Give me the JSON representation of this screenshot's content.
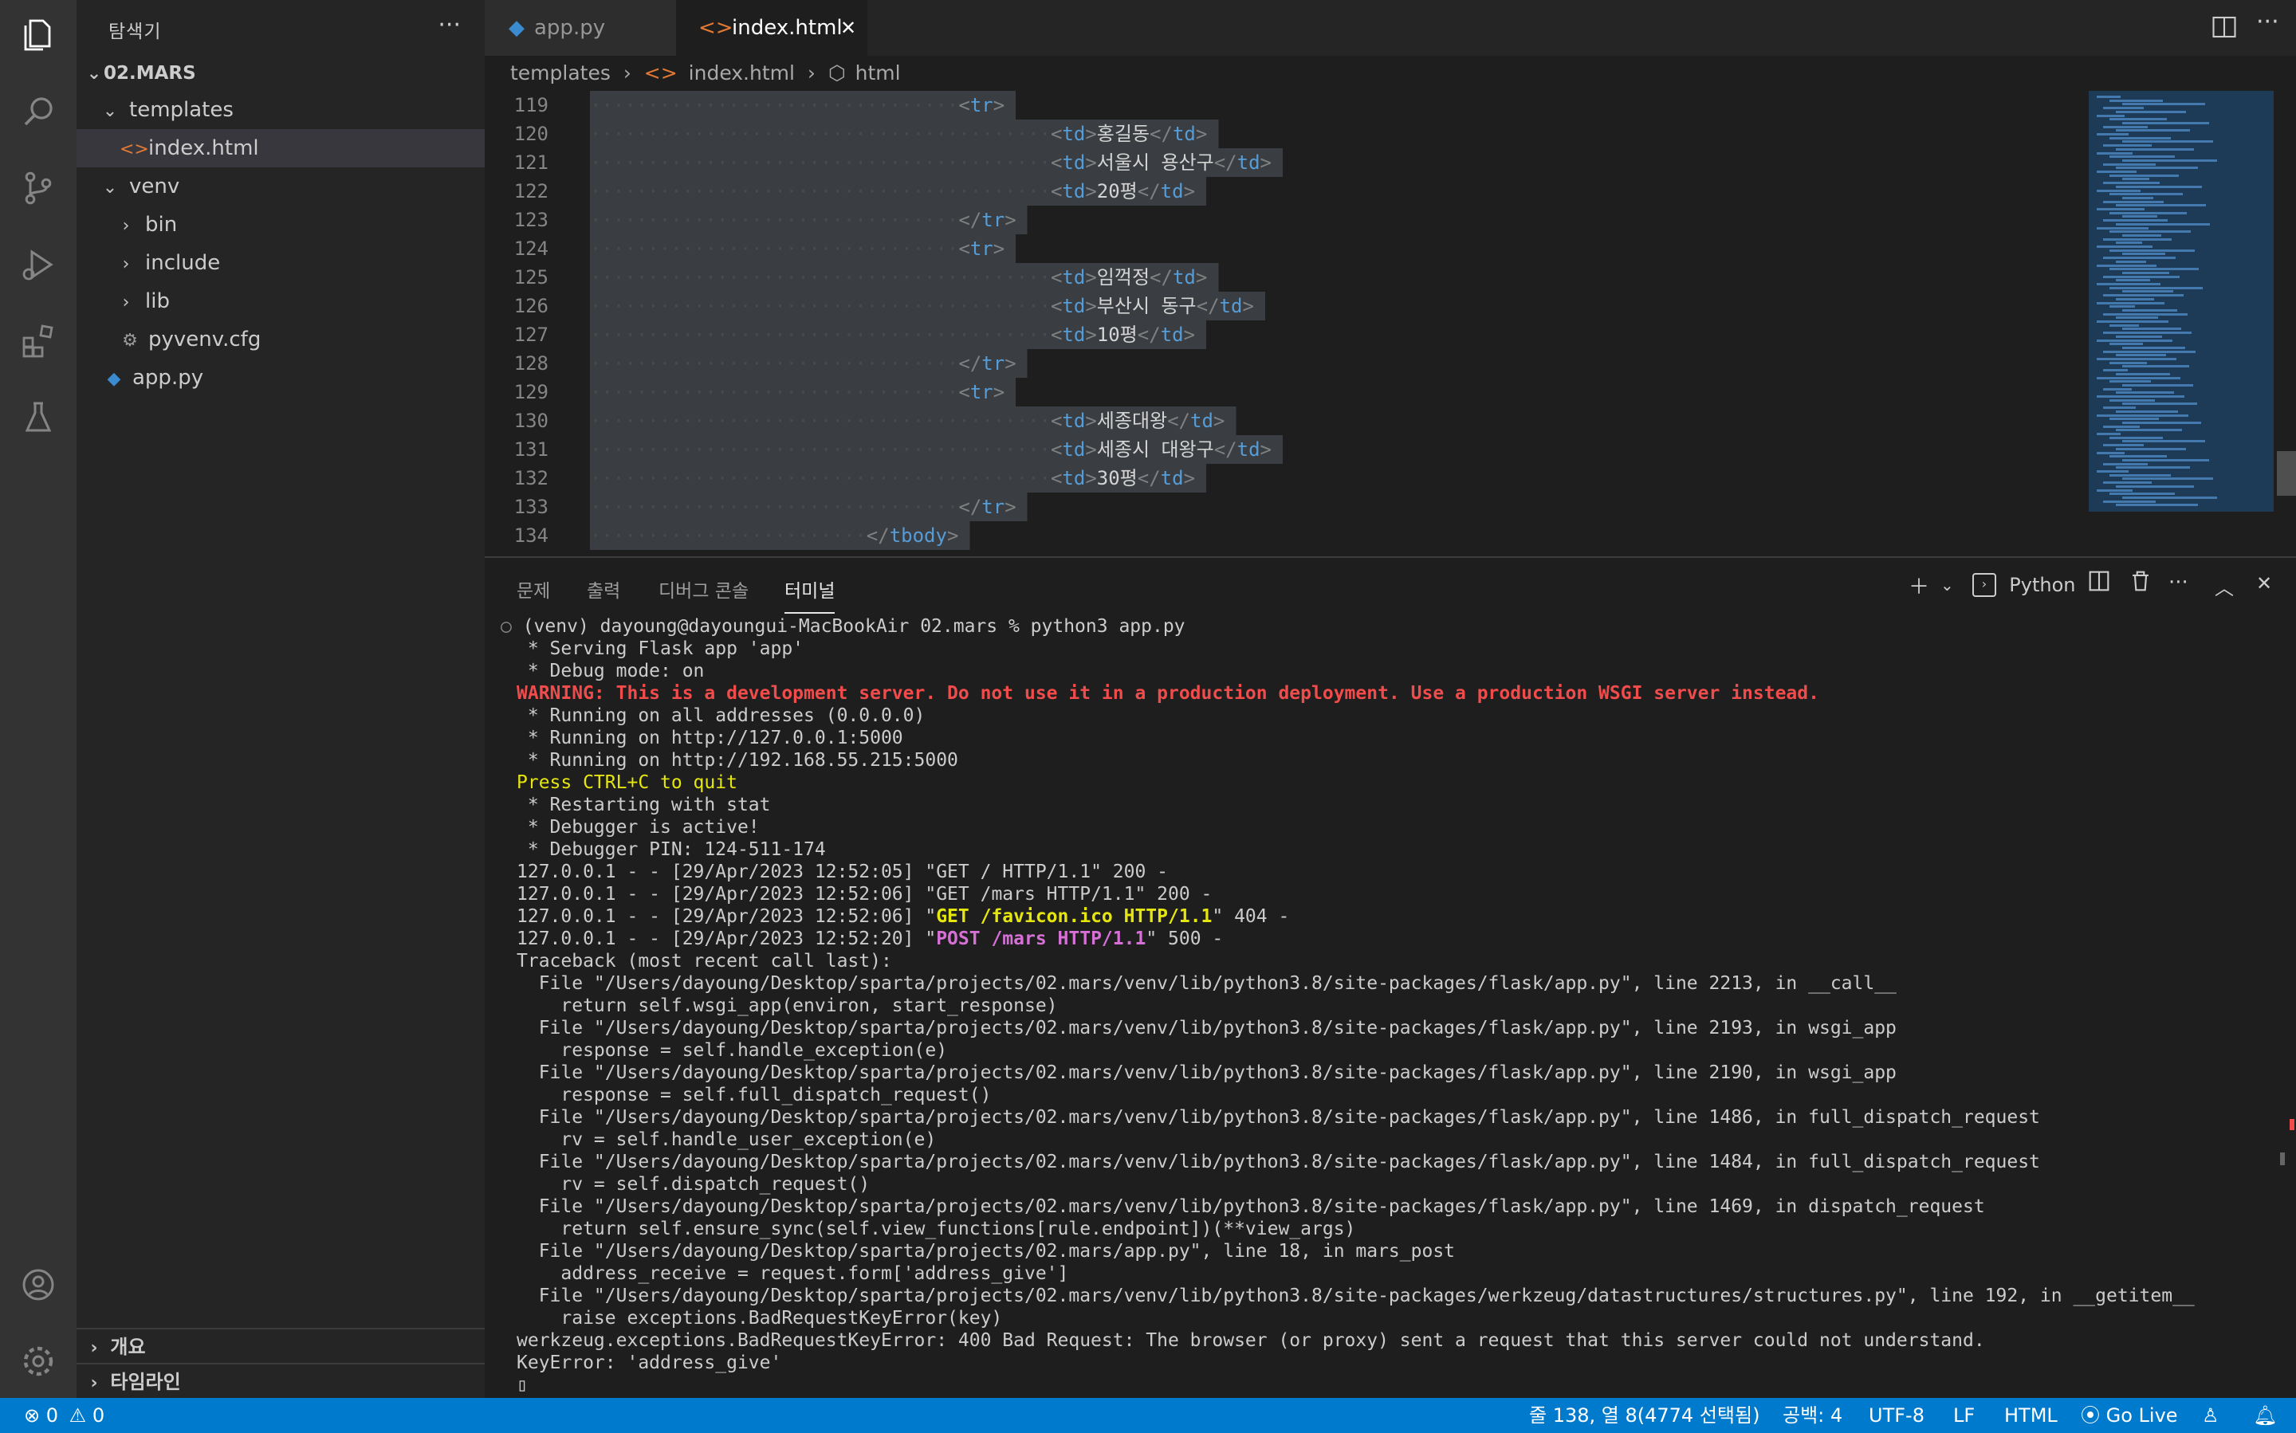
{
  "sidebar": {
    "title": "탐색기",
    "more": "···",
    "workspace": "02.MARS",
    "tree": [
      {
        "label": "templates",
        "kind": "folder-open",
        "indent": 1
      },
      {
        "label": "index.html",
        "kind": "html",
        "indent": 2,
        "selected": true
      },
      {
        "label": "venv",
        "kind": "folder-open",
        "indent": 1
      },
      {
        "label": "bin",
        "kind": "folder-closed",
        "indent": 2
      },
      {
        "label": "include",
        "kind": "folder-closed",
        "indent": 2
      },
      {
        "label": "lib",
        "kind": "folder-closed",
        "indent": 2
      },
      {
        "label": "pyvenv.cfg",
        "kind": "gear",
        "indent": 2
      },
      {
        "label": "app.py",
        "kind": "python",
        "indent": 1
      }
    ],
    "outline": "개요",
    "timeline": "타임라인"
  },
  "tabs": [
    {
      "label": "app.py",
      "active": false
    },
    {
      "label": "index.html",
      "active": true
    }
  ],
  "breadcrumb": [
    "templates",
    "index.html",
    "html"
  ],
  "code_lines": [
    {
      "n": "119",
      "indent": 16,
      "html": "tr-open"
    },
    {
      "n": "120",
      "indent": 20,
      "content": "홍길동"
    },
    {
      "n": "121",
      "indent": 20,
      "content": "서울시 용산구"
    },
    {
      "n": "122",
      "indent": 20,
      "content": "20평"
    },
    {
      "n": "123",
      "indent": 16,
      "html": "tr-close"
    },
    {
      "n": "124",
      "indent": 16,
      "html": "tr-open"
    },
    {
      "n": "125",
      "indent": 20,
      "content": "임꺽정"
    },
    {
      "n": "126",
      "indent": 20,
      "content": "부산시 동구"
    },
    {
      "n": "127",
      "indent": 20,
      "content": "10평"
    },
    {
      "n": "128",
      "indent": 16,
      "html": "tr-close"
    },
    {
      "n": "129",
      "indent": 16,
      "html": "tr-open"
    },
    {
      "n": "130",
      "indent": 20,
      "content": "세종대왕"
    },
    {
      "n": "131",
      "indent": 20,
      "content": "세종시 대왕구"
    },
    {
      "n": "132",
      "indent": 20,
      "content": "30평"
    },
    {
      "n": "133",
      "indent": 16,
      "html": "tr-close"
    },
    {
      "n": "134",
      "indent": 12,
      "html": "tbody-close"
    }
  ],
  "panel": {
    "tabs": [
      "문제",
      "출력",
      "디버그 콘솔",
      "터미널"
    ],
    "active_tab": "터미널",
    "shell": "Python"
  },
  "terminal": {
    "prompt": "(venv) dayoung@dayoungui-MacBookAir 02.mars % python3 app.py",
    "lines": [
      {
        "text": " * Serving Flask app 'app'",
        "style": ""
      },
      {
        "text": " * Debug mode: on",
        "style": ""
      },
      {
        "text": "WARNING: This is a development server. Do not use it in a production deployment. Use a production WSGI server instead.",
        "style": "red"
      },
      {
        "text": " * Running on all addresses (0.0.0.0)",
        "style": ""
      },
      {
        "text": " * Running on http://127.0.0.1:5000",
        "style": ""
      },
      {
        "text": " * Running on http://192.168.55.215:5000",
        "style": ""
      },
      {
        "text": "Press CTRL+C to quit",
        "style": "yellow"
      },
      {
        "text": " * Restarting with stat",
        "style": ""
      },
      {
        "text": " * Debugger is active!",
        "style": ""
      },
      {
        "text": " * Debugger PIN: 124-511-174",
        "style": ""
      },
      {
        "pre": "127.0.0.1 - - [29/Apr/2023 12:52:05] \"",
        "hl": "GET / HTTP/1.1",
        "post": "\" 200 -",
        "style": ""
      },
      {
        "pre": "127.0.0.1 - - [29/Apr/2023 12:52:06] \"",
        "hl": "GET /mars HTTP/1.1",
        "post": "\" 200 -",
        "style": ""
      },
      {
        "pre": "127.0.0.1 - - [29/Apr/2023 12:52:06] \"",
        "hl": "GET /favicon.ico HTTP/1.1",
        "post": "\" 404 -",
        "style": "yellow"
      },
      {
        "pre": "127.0.0.1 - - [29/Apr/2023 12:52:20] \"",
        "hl": "POST /mars HTTP/1.1",
        "post": "\" 500 -",
        "style": "magenta"
      },
      {
        "text": "Traceback (most recent call last):",
        "style": ""
      },
      {
        "text": "  File \"/Users/dayoung/Desktop/sparta/projects/02.mars/venv/lib/python3.8/site-packages/flask/app.py\", line 2213, in __call__",
        "style": ""
      },
      {
        "text": "    return self.wsgi_app(environ, start_response)",
        "style": ""
      },
      {
        "text": "  File \"/Users/dayoung/Desktop/sparta/projects/02.mars/venv/lib/python3.8/site-packages/flask/app.py\", line 2193, in wsgi_app",
        "style": ""
      },
      {
        "text": "    response = self.handle_exception(e)",
        "style": ""
      },
      {
        "text": "  File \"/Users/dayoung/Desktop/sparta/projects/02.mars/venv/lib/python3.8/site-packages/flask/app.py\", line 2190, in wsgi_app",
        "style": ""
      },
      {
        "text": "    response = self.full_dispatch_request()",
        "style": ""
      },
      {
        "text": "  File \"/Users/dayoung/Desktop/sparta/projects/02.mars/venv/lib/python3.8/site-packages/flask/app.py\", line 1486, in full_dispatch_request",
        "style": ""
      },
      {
        "text": "    rv = self.handle_user_exception(e)",
        "style": ""
      },
      {
        "text": "  File \"/Users/dayoung/Desktop/sparta/projects/02.mars/venv/lib/python3.8/site-packages/flask/app.py\", line 1484, in full_dispatch_request",
        "style": ""
      },
      {
        "text": "    rv = self.dispatch_request()",
        "style": ""
      },
      {
        "text": "  File \"/Users/dayoung/Desktop/sparta/projects/02.mars/venv/lib/python3.8/site-packages/flask/app.py\", line 1469, in dispatch_request",
        "style": ""
      },
      {
        "text": "    return self.ensure_sync(self.view_functions[rule.endpoint])(**view_args)",
        "style": ""
      },
      {
        "text": "  File \"/Users/dayoung/Desktop/sparta/projects/02.mars/app.py\", line 18, in mars_post",
        "style": ""
      },
      {
        "text": "    address_receive = request.form['address_give']",
        "style": ""
      },
      {
        "text": "  File \"/Users/dayoung/Desktop/sparta/projects/02.mars/venv/lib/python3.8/site-packages/werkzeug/datastructures/structures.py\", line 192, in __getitem__",
        "style": ""
      },
      {
        "text": "    raise exceptions.BadRequestKeyError(key)",
        "style": ""
      },
      {
        "text": "werkzeug.exceptions.BadRequestKeyError: 400 Bad Request: The browser (or proxy) sent a request that this server could not understand.",
        "style": ""
      },
      {
        "text": "KeyError: 'address_give'",
        "style": ""
      }
    ]
  },
  "statusbar": {
    "errors": "0",
    "warnings": "0",
    "position": "줄 138, 열 8(4774 선택됨)",
    "spaces": "공백: 4",
    "encoding": "UTF-8",
    "eol": "LF",
    "language": "HTML",
    "golive": "Go Live"
  },
  "colors": {
    "accent": "#007acc",
    "warning": "#f14c4c",
    "highlight": "#e5e510",
    "post": "#d670d6"
  }
}
